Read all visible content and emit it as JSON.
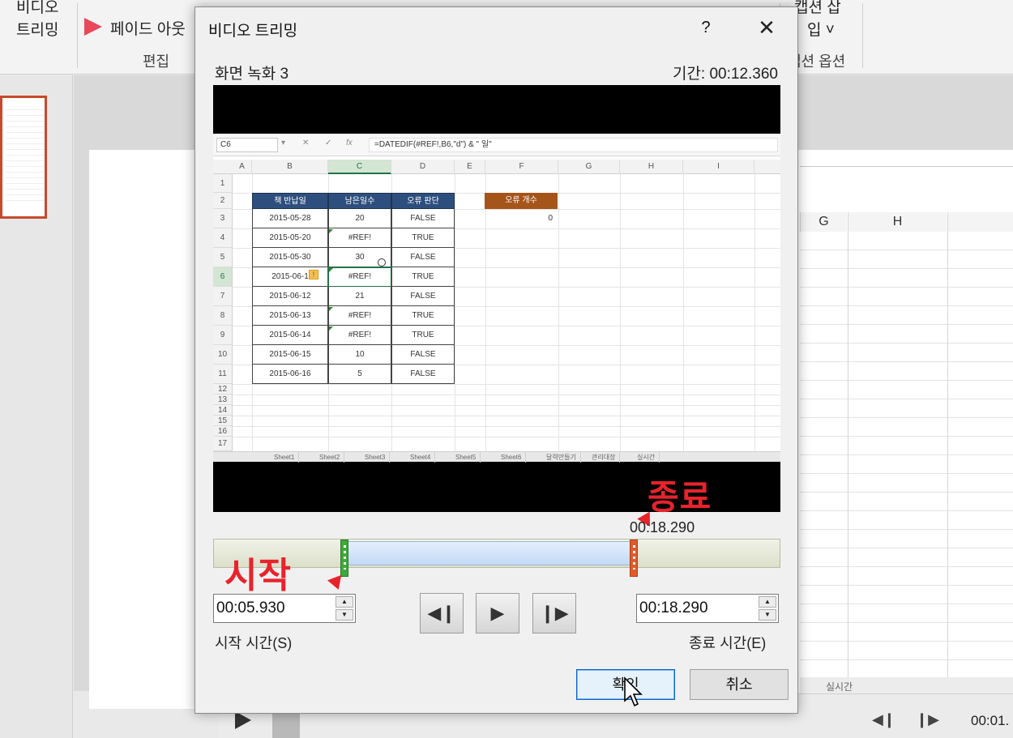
{
  "ribbon": {
    "video_label_1": "비디오",
    "video_label_2": "트리밍",
    "fade_out": "페이드 아웃",
    "edit_group": "편집",
    "caption_1": "캡션 삽",
    "caption_2": "입 ˅",
    "caption_group": "캡션 옵션"
  },
  "background": {
    "col_g": "G",
    "col_h": "H",
    "sheet_tab": "실시간",
    "time": "00:01."
  },
  "dialog": {
    "title": "비디오 트리밍",
    "help": "?",
    "close": "✕",
    "video_name": "화면 녹화 3",
    "duration": "기간: 00:12.360"
  },
  "excel": {
    "name_box": "C6",
    "formula": "=DATEDIF(#REF!,B6,\"d\") & \" 일\"",
    "columns": [
      "A",
      "B",
      "C",
      "D",
      "E",
      "F",
      "G",
      "H",
      "I"
    ],
    "rows": [
      "1",
      "2",
      "3",
      "4",
      "5",
      "6",
      "7",
      "8",
      "9",
      "10",
      "11",
      "12",
      "13",
      "14",
      "15",
      "16",
      "17"
    ],
    "headers": [
      "책 반납일",
      "남은일수",
      "오류 판단"
    ],
    "table": [
      [
        "2015-05-28",
        "20",
        "FALSE"
      ],
      [
        "2015-05-20",
        "#REF!",
        "TRUE"
      ],
      [
        "2015-05-30",
        "30",
        "FALSE"
      ],
      [
        "2015-06-1",
        "#REF!",
        "TRUE"
      ],
      [
        "2015-06-12",
        "21",
        "FALSE"
      ],
      [
        "2015-06-13",
        "#REF!",
        "TRUE"
      ],
      [
        "2015-06-14",
        "#REF!",
        "TRUE"
      ],
      [
        "2015-06-15",
        "10",
        "FALSE"
      ],
      [
        "2015-06-16",
        "5",
        "FALSE"
      ]
    ],
    "error_count_label": "오류 개수",
    "error_count_value": "0",
    "sheet_tabs": [
      "Sheet1",
      "Sheet2",
      "Sheet3",
      "Sheet4",
      "Sheet5",
      "Sheet6",
      "달력만들기",
      "관리대장",
      "실시간"
    ]
  },
  "annotations": {
    "start": "시작",
    "end": "종료",
    "color": "#e8232c"
  },
  "timeline": {
    "end_marker_label": "00:18.290",
    "selection_start_fraction": 0.23,
    "selection_end_fraction": 0.74
  },
  "controls": {
    "start_time": "00:05.930",
    "start_label": "시작 시간(S)",
    "end_time": "00:18.290",
    "end_label": "종료 시간(E)",
    "prev_frame": "◀❙",
    "play": "▶",
    "next_frame": "❙▶",
    "ok": "확인",
    "cancel": "취소"
  }
}
